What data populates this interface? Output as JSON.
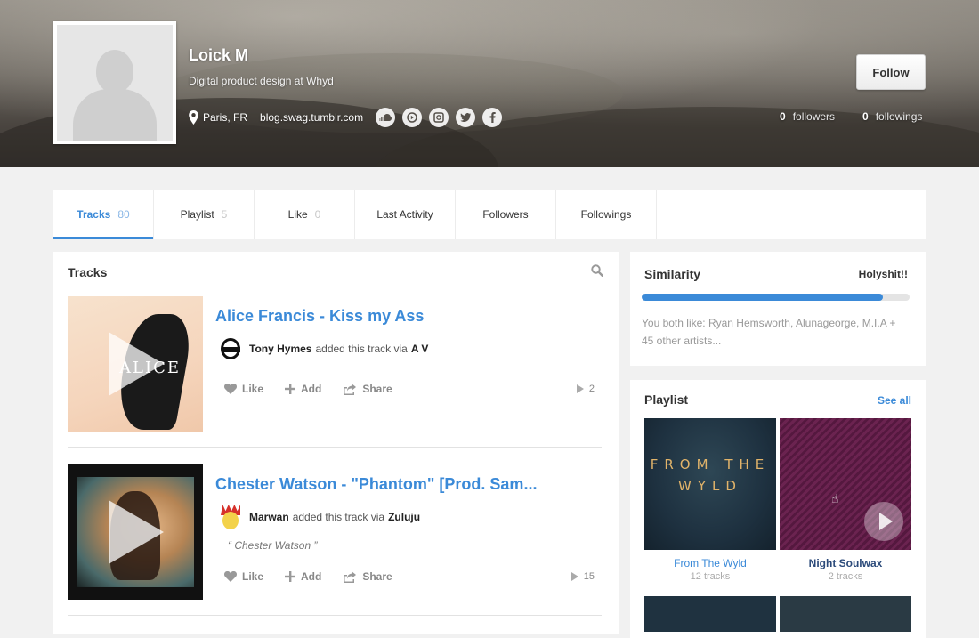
{
  "profile": {
    "name": "Loick M",
    "bio": "Digital product design at Whyd",
    "location": "Paris, FR",
    "website": "blog.swag.tumblr.com",
    "social": [
      "soundcloud-icon",
      "youtube-icon",
      "instagram-icon",
      "twitter-icon",
      "facebook-icon"
    ],
    "follow_label": "Follow",
    "followers_count": "0",
    "followers_label": "followers",
    "followings_count": "0",
    "followings_label": "followings"
  },
  "tabs": [
    {
      "label": "Tracks",
      "count": "80"
    },
    {
      "label": "Playlist",
      "count": "5"
    },
    {
      "label": "Like",
      "count": "0"
    },
    {
      "label": "Last Activity",
      "count": ""
    },
    {
      "label": "Followers",
      "count": ""
    },
    {
      "label": "Followings",
      "count": ""
    }
  ],
  "tracks_panel": {
    "title": "Tracks",
    "items": [
      {
        "title": "Alice Francis - Kiss my Ass",
        "user": "Tony Hymes",
        "added_text": "added this track via",
        "via": "A V",
        "quote": "",
        "plays": "2",
        "thumb_text": "ALICE"
      },
      {
        "title": "Chester Watson - \"Phantom\" [Prod. Sam...",
        "user": "Marwan",
        "added_text": "added this track via",
        "via": "Zuluju",
        "quote": "“ Chester Watson ”",
        "plays": "15"
      }
    ],
    "actions": {
      "like": "Like",
      "add": "Add",
      "share": "Share"
    }
  },
  "similarity": {
    "title": "Similarity",
    "level": "Holyshit!!",
    "percent": 90,
    "text": "You both like: Ryan Hemsworth, Alunageorge, M.I.A + 45 other artists..."
  },
  "playlist": {
    "title": "Playlist",
    "see_all": "See all",
    "items": [
      {
        "name": "From The Wyld",
        "count": "12 tracks",
        "cover_text": "FROM THE WYLD"
      },
      {
        "name": "Night Soulwax",
        "count": "2 tracks"
      }
    ]
  },
  "colors": {
    "accent": "#3b8ad8"
  }
}
